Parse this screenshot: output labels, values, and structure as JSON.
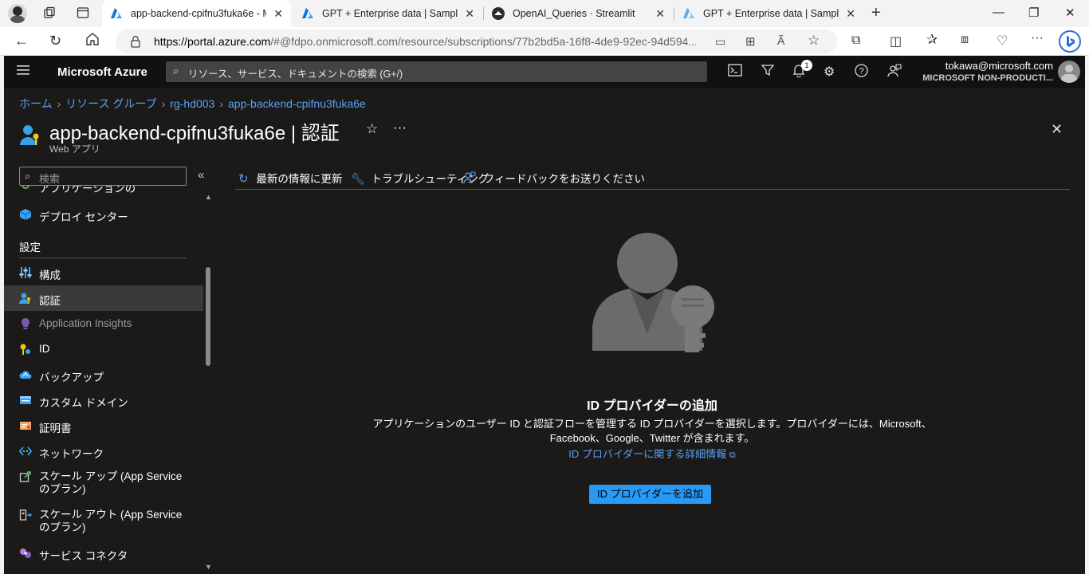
{
  "browser": {
    "tabs": [
      {
        "title": "app-backend-cpifnu3fuka6e - Mi",
        "icon": "azure-icon",
        "active": true
      },
      {
        "title": "GPT + Enterprise data | Sample",
        "icon": "azure-icon",
        "active": false
      },
      {
        "title": "OpenAI_Queries · Streamlit",
        "icon": "streamlit-icon",
        "active": false
      },
      {
        "title": "GPT + Enterprise data | Sample",
        "icon": "azure-icon",
        "active": false
      }
    ],
    "url_host": "https://portal.azure.com",
    "url_rest": "/#@fdpo.onmicrosoft.com/resource/subscriptions/77b2bd5a-16f8-4de9-92ec-94d594..."
  },
  "portal": {
    "brand": "Microsoft Azure",
    "search_placeholder": "リソース、サービス、ドキュメントの検索 (G+/)",
    "notification_count": "1",
    "user_email": "tokawa@microsoft.com",
    "user_tenant": "MICROSOFT NON-PRODUCTI..."
  },
  "breadcrumb": [
    "ホーム",
    "リソース グループ",
    "rg-hd003",
    "app-backend-cpifnu3fuka6e"
  ],
  "page": {
    "title": "app-backend-cpifnu3fuka6e | 認証",
    "subtitle": "Web アプリ"
  },
  "sidebar": {
    "search_placeholder": "検索",
    "partial_item": "アプリケーションの",
    "items_top": [
      {
        "label": "デプロイ センター",
        "icon": "deploy-center-icon"
      }
    ],
    "section": "設定",
    "items": [
      {
        "label": "構成",
        "icon": "config-icon",
        "selected": false,
        "dim": false
      },
      {
        "label": "認証",
        "icon": "auth-icon",
        "selected": true,
        "dim": false
      },
      {
        "label": "Application Insights",
        "icon": "insights-icon",
        "selected": false,
        "dim": true
      },
      {
        "label": "ID",
        "icon": "identity-icon",
        "selected": false,
        "dim": false
      },
      {
        "label": "バックアップ",
        "icon": "backup-icon",
        "selected": false,
        "dim": false
      },
      {
        "label": "カスタム ドメイン",
        "icon": "domain-icon",
        "selected": false,
        "dim": false
      },
      {
        "label": "証明書",
        "icon": "certificate-icon",
        "selected": false,
        "dim": false
      },
      {
        "label": "ネットワーク",
        "icon": "network-icon",
        "selected": false,
        "dim": false
      },
      {
        "label": "スケール アップ (App Service のプラン)",
        "icon": "scale-up-icon",
        "selected": false,
        "dim": false
      },
      {
        "label": "スケール アウト (App Service のプラン)",
        "icon": "scale-out-icon",
        "selected": false,
        "dim": false
      },
      {
        "label": "サービス コネクタ",
        "icon": "service-connector-icon",
        "selected": false,
        "dim": false
      }
    ]
  },
  "toolbar": {
    "refresh": "最新の情報に更新",
    "troubleshoot": "トラブルシューティング",
    "feedback": "フィードバックをお送りください"
  },
  "empty_state": {
    "title": "ID プロバイダーの追加",
    "desc_line1": "アプリケーションのユーザー ID と認証フローを管理する ID プロバイダーを選択します。プロバイダーには、Microsoft、",
    "desc_line2": "Facebook、Google、Twitter が含まれます。",
    "link": "ID プロバイダーに関する詳細情報",
    "button": "ID プロバイダーを追加"
  },
  "colors": {
    "portal_bg": "#1b1a19",
    "topnav_bg": "#111111",
    "accent": "#2899f5",
    "link": "#5aa0f2"
  }
}
